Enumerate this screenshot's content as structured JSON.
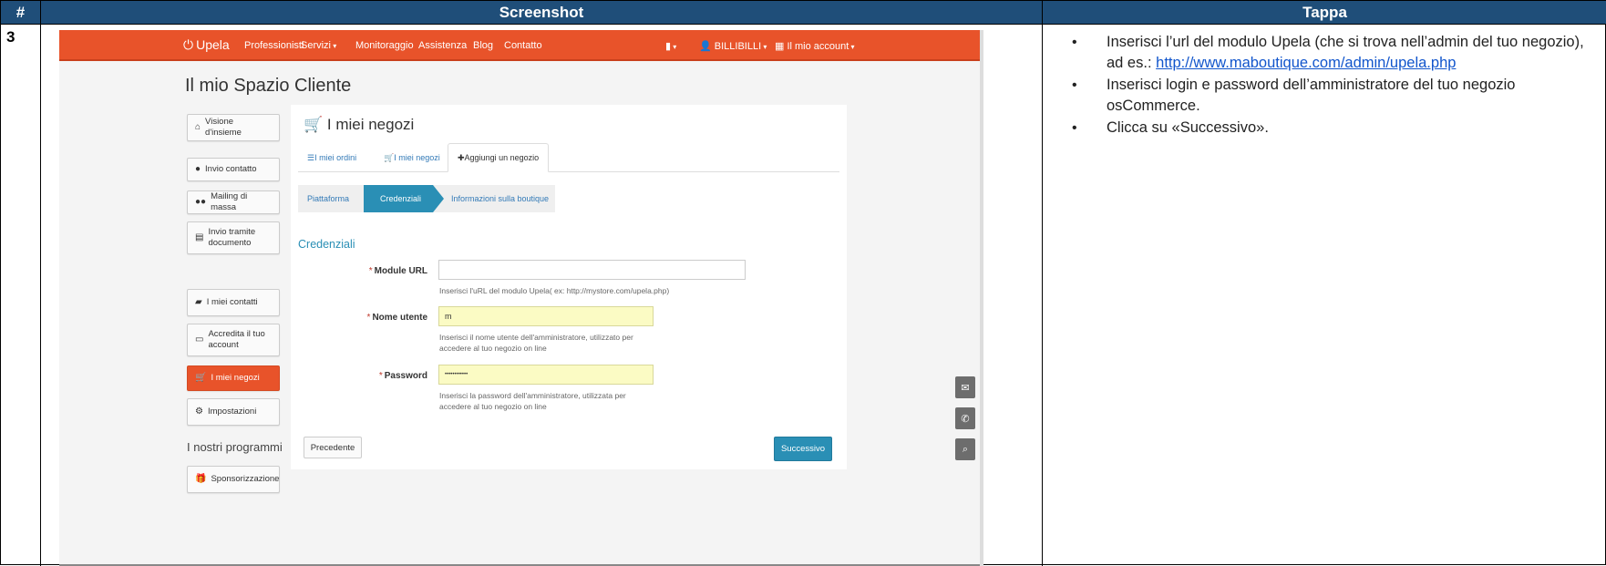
{
  "table": {
    "col_num": "#",
    "col_screenshot": "Screenshot",
    "col_step": "Tappa",
    "row_num": "3"
  },
  "steps": {
    "b1_text": "Inserisci l’url del modulo Upela (che si trova nell’admin del tuo negozio), ad es.:",
    "b1_link": "http://www.maboutique.com/admin/upela.php",
    "b2": "Inserisci login e password dell’amministratore del tuo negozio osCommerce.",
    "b3": "Clicca su «Successivo»."
  },
  "nav": {
    "logo": "Upela",
    "items": [
      "Professionisti",
      "Servizi",
      "Monitoraggio",
      "Assistenza",
      "Blog",
      "Contatto"
    ],
    "user": "BILLIBILLI",
    "account": "Il mio account"
  },
  "page": {
    "title": "Il mio Spazio Cliente",
    "programs_title": "I nostri programmi"
  },
  "sidebar": {
    "items": [
      {
        "label": "Visione d'insieme",
        "icon": "home-icon"
      },
      {
        "label": "Invio contatto",
        "icon": "user-icon"
      },
      {
        "label": "Mailing di massa",
        "icon": "users-icon"
      },
      {
        "label": "Invio tramite documento",
        "icon": "file-icon"
      },
      {
        "label": "I miei contatti",
        "icon": "book-icon"
      },
      {
        "label": "Accredita il tuo account",
        "icon": "card-icon"
      },
      {
        "label": "I miei negozi",
        "icon": "cart-icon"
      },
      {
        "label": "Impostazioni",
        "icon": "gear-icon"
      },
      {
        "label": "Sponsorizzazione",
        "icon": "gift-icon"
      }
    ]
  },
  "panel": {
    "title": "I miei negozi",
    "tabs": [
      "I miei ordini",
      "I miei negozi",
      "Aggiungi un negozio"
    ],
    "steps": [
      "Piattaforma",
      "Credenziali",
      "Informazioni sulla boutique"
    ],
    "section": "Credenziali"
  },
  "form": {
    "module_url_label": "Module URL",
    "module_url_value": "",
    "module_url_help": "Inserisci l'uRL del modulo Upela( ex: http://mystore.com/upela.php)",
    "username_label": "Nome utente",
    "username_value": "m",
    "username_help": "Inserisci il nome utente dell'amministratore, utilizzato per accedere al tuo negozio on line",
    "password_label": "Password",
    "password_value": "••••••••••••",
    "password_help": "Inserisci la password dell'amministratore, utilizzata per accedere al tuo negozio on line",
    "required_mark": "*"
  },
  "buttons": {
    "prev": "Precedente",
    "next": "Successivo"
  },
  "colors": {
    "nav": "#e8532a",
    "accent": "#2a8fb5",
    "header": "#1f4e79"
  }
}
